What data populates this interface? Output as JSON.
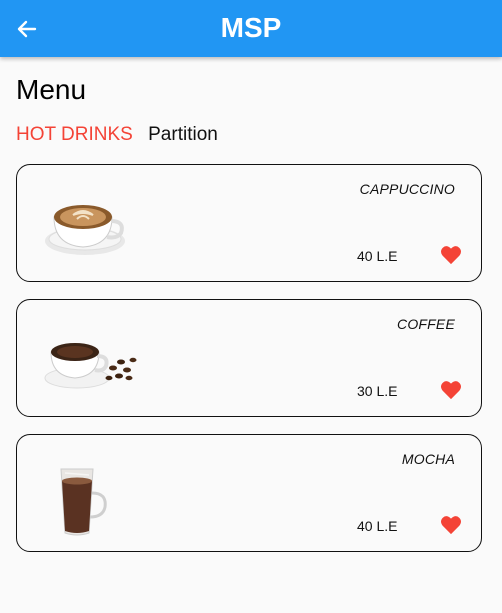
{
  "appbar": {
    "title": "MSP",
    "back_icon": "arrow-left-icon"
  },
  "menu": {
    "title": "Menu"
  },
  "category": {
    "active": "HOT DRINKS",
    "label": "Partition"
  },
  "items": [
    {
      "name": "CAPPUCCINO",
      "price": "40 L.E",
      "image": "cappuccino-image",
      "favorite": true
    },
    {
      "name": "COFFEE",
      "price": "30 L.E",
      "image": "coffee-image",
      "favorite": true
    },
    {
      "name": "MOCHA",
      "price": "40 L.E",
      "image": "mocha-image",
      "favorite": true
    }
  ],
  "colors": {
    "appbar": "#2196f3",
    "accent": "#f44336",
    "heart": "#f44336"
  }
}
